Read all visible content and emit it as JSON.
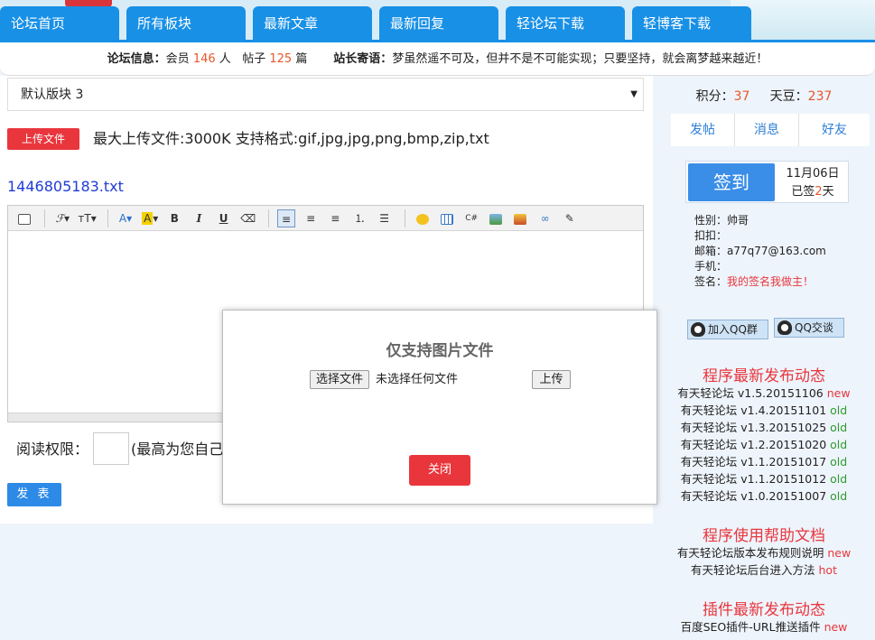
{
  "nav": {
    "tabs": [
      "论坛首页",
      "所有板块",
      "最新文章",
      "最新回复",
      "轻论坛下载",
      "轻博客下载"
    ]
  },
  "infobar": {
    "forum_label": "论坛信息：",
    "members_prefix": "会员",
    "members_count": "146",
    "members_unit": "人",
    "posts_prefix": "帖子",
    "posts_count": "125",
    "posts_unit": "篇",
    "motto_label": "站长寄语：",
    "motto_text": "梦虽然遥不可及，但并不是不可能实现；只要坚持，就会离梦越来越近！"
  },
  "form": {
    "board_select": "默认版块 3",
    "upload_button": "上传文件",
    "upload_info": "最大上传文件:3000K   支持格式:gif,jpg,jpg,png,bmp,zip,txt",
    "uploaded_file": "1446805183.txt",
    "permission_label": "阅读权限：",
    "permission_value": "",
    "permission_note": "(最高为您自己的",
    "post_button": "发 表"
  },
  "modal": {
    "title": "仅支持图片文件",
    "choose_button": "选择文件",
    "no_file_text": "未选择任何文件",
    "upload_button": "上传",
    "close_button": "关闭"
  },
  "sidebar": {
    "score_label": "积分：",
    "score_value": "37",
    "beans_label": "天豆：",
    "beans_value": "237",
    "tabs": [
      "发帖",
      "消息",
      "好友"
    ],
    "checkin_button": "签到",
    "checkin_date": "11月06日",
    "checkin_prefix": "已签",
    "checkin_days": "2",
    "checkin_suffix": "天",
    "profile": {
      "gender": "性别：帅哥",
      "qq": "扣扣：",
      "email": "邮箱：a77q77@163.com",
      "phone": "手机：",
      "sign_label": "签名：",
      "sign_value": "我的签名我做主！"
    },
    "qq_group_button": "加入QQ群",
    "qq_chat_button": "QQ交谈",
    "release_title": "程序最新发布动态",
    "releases": [
      {
        "name": "有天轻论坛 v1.5.20151106",
        "tag": "new"
      },
      {
        "name": "有天轻论坛 v1.4.20151101",
        "tag": "old"
      },
      {
        "name": "有天轻论坛 v1.3.20151025",
        "tag": "old"
      },
      {
        "name": "有天轻论坛 v1.2.20151020",
        "tag": "old"
      },
      {
        "name": "有天轻论坛 v1.1.20151017",
        "tag": "old"
      },
      {
        "name": "有天轻论坛 v1.1.20151012",
        "tag": "old"
      },
      {
        "name": "有天轻论坛 v1.0.20151007",
        "tag": "old"
      }
    ],
    "help_title": "程序使用帮助文档",
    "help_docs": [
      {
        "name": "有天轻论坛版本发布规则说明",
        "tag": "new"
      },
      {
        "name": "有天轻论坛后台进入方法",
        "tag": "hot"
      }
    ],
    "plugin_title": "插件最新发布动态",
    "plugins": [
      {
        "name": "百度SEO插件-URL推送插件",
        "tag": "new"
      }
    ]
  },
  "colors": {
    "nav_blue": "#1890e6",
    "accent_red": "#e9363d",
    "link_blue": "#1f3cd6",
    "old_green": "#2f9a2f"
  }
}
